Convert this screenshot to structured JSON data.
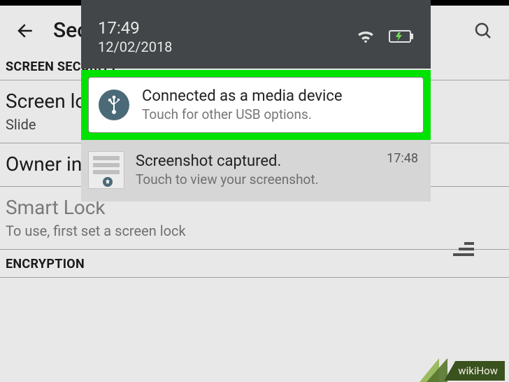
{
  "statusbar": {
    "time": "17:49",
    "date": "12/02/2018"
  },
  "settings": {
    "page_title": "Security",
    "sections": {
      "screen_security": {
        "header": "SCREEN SECURITY"
      },
      "encryption": {
        "header": "ENCRYPTION"
      }
    },
    "items": {
      "screen_lock": {
        "title": "Screen lock",
        "subtitle": "Slide"
      },
      "owner_info": {
        "title": "Owner info"
      },
      "smart_lock": {
        "title": "Smart Lock",
        "subtitle": "To use, first set a screen lock"
      }
    }
  },
  "notifications": [
    {
      "icon": "usb-icon",
      "title": "Connected as a media device",
      "subtitle": "Touch for other USB options."
    },
    {
      "icon": "screenshot-thumb",
      "title": "Screenshot captured.",
      "subtitle": "Touch to view your screenshot.",
      "time": "17:48"
    }
  ],
  "watermark": {
    "text": "wikiHow"
  }
}
